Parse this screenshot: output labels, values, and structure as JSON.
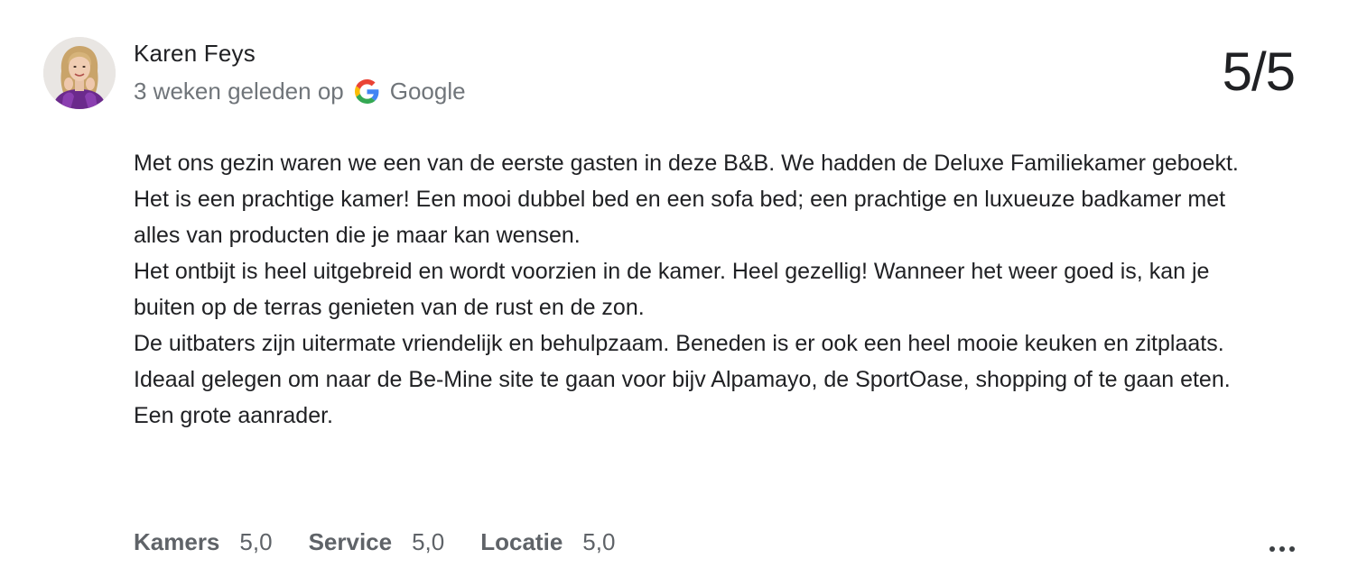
{
  "review": {
    "reviewer_name": "Karen Feys",
    "time_ago": "3 weken geleden op",
    "source": "Google",
    "score": "5/5",
    "paragraphs": [
      "Met ons gezin waren we een van de eerste gasten in deze B&B. We hadden de Deluxe Familiekamer geboekt. Het is een prachtige kamer! Een mooi dubbel bed en een sofa bed; een prachtige en luxueuze badkamer met alles van producten die je maar kan wensen.",
      "Het ontbijt is heel uitgebreid en wordt voorzien in de kamer. Heel gezellig! Wanneer het weer goed is, kan je buiten op de terras genieten van de rust en de zon.",
      "De uitbaters zijn uitermate vriendelijk en behulpzaam. Beneden is er ook een heel mooie keuken en zitplaats.",
      "Ideaal gelegen om naar de Be-Mine site te gaan voor bijv Alpamayo, de SportOase, shopping of te gaan eten.",
      "Een grote aanrader."
    ],
    "ratings": [
      {
        "label": "Kamers",
        "value": "5,0"
      },
      {
        "label": "Service",
        "value": "5,0"
      },
      {
        "label": "Locatie",
        "value": "5,0"
      }
    ]
  },
  "icons": {
    "source_icon": "google-g-icon",
    "menu_icon": "more-horizontal-icon",
    "avatar": "user-avatar"
  },
  "colors": {
    "text_primary": "#202124",
    "text_secondary": "#70757a",
    "google_blue": "#4285F4",
    "google_red": "#EA4335",
    "google_yellow": "#FBBC05",
    "google_green": "#34A853",
    "avatar_outfit": "#6b2a8c"
  }
}
